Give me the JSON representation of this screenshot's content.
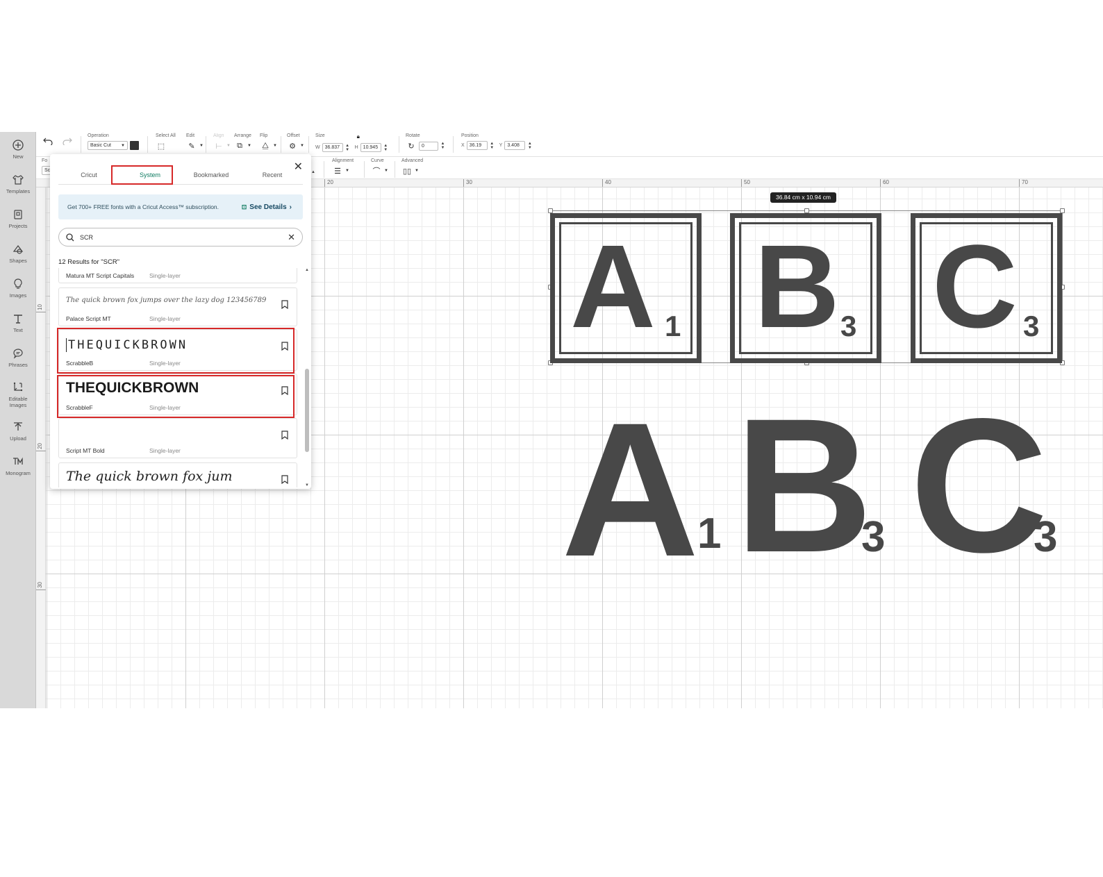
{
  "sidebar": {
    "items": [
      {
        "label": "New",
        "icon": "plus-circle-icon"
      },
      {
        "label": "Templates",
        "icon": "shirt-icon"
      },
      {
        "label": "Projects",
        "icon": "projects-icon"
      },
      {
        "label": "Shapes",
        "icon": "shapes-icon"
      },
      {
        "label": "Images",
        "icon": "lightbulb-icon"
      },
      {
        "label": "Text",
        "icon": "text-icon"
      },
      {
        "label": "Phrases",
        "icon": "speech-bubble-icon"
      },
      {
        "label": "Editable Images",
        "icon": "editable-images-icon"
      },
      {
        "label": "Upload",
        "icon": "upload-icon"
      },
      {
        "label": "Monogram",
        "icon": "monogram-icon"
      }
    ]
  },
  "toolbar": {
    "operation_label": "Operation",
    "operation_value": "Basic Cut",
    "select_all_label": "Select All",
    "edit_label": "Edit",
    "align_label": "Align",
    "arrange_label": "Arrange",
    "flip_label": "Flip",
    "offset_label": "Offset",
    "size_label": "Size",
    "w_label": "W",
    "w_value": "36.837",
    "h_label": "H",
    "h_value": "10.945",
    "rotate_label": "Rotate",
    "rotate_value": "0",
    "position_label": "Position",
    "x_label": "X",
    "x_value": "36.19",
    "y_label": "Y",
    "y_value": "3.408"
  },
  "toolbar2": {
    "font_label_partial": "Fo",
    "font_value_partial": "Sc",
    "alignment_label": "Alignment",
    "curve_label": "Curve",
    "advanced_label": "Advanced"
  },
  "rulers": {
    "top": [
      "20",
      "30",
      "40",
      "50",
      "60",
      "70"
    ],
    "left": [
      "10",
      "20",
      "30"
    ]
  },
  "font_panel": {
    "tabs": [
      "Cricut",
      "System",
      "Bookmarked",
      "Recent"
    ],
    "active_tab": "System",
    "banner_text": "Get 700+ FREE fonts with a Cricut Access™ subscription.",
    "banner_link": "See Details",
    "search_value": "SCR",
    "results_count": "12 Results for \"SCR\"",
    "fonts": [
      {
        "name": "Matura MT Script Capitals",
        "type": "Single-layer",
        "sample": ""
      },
      {
        "name": "Palace Script MT",
        "type": "Single-layer",
        "sample": "The quick brown fox jumps over the lazy dog 123456789"
      },
      {
        "name": "ScrabbleB",
        "type": "Single-layer",
        "sample": "THEQUICKBROWN"
      },
      {
        "name": "ScrabbleF",
        "type": "Single-layer",
        "sample": "THEQUICKBROWN"
      },
      {
        "name": "Script MT Bold",
        "type": "Single-layer",
        "sample": ""
      },
      {
        "name": "",
        "type": "",
        "sample": "The quick brown fox jum"
      }
    ]
  },
  "canvas": {
    "size_badge": "36.84  cm x 10.94  cm",
    "tiles": [
      {
        "letter": "A",
        "score": "1"
      },
      {
        "letter": "B",
        "score": "3"
      },
      {
        "letter": "C",
        "score": "3"
      }
    ],
    "large_letters": [
      {
        "letter": "A",
        "score": "1"
      },
      {
        "letter": "B",
        "score": "3"
      },
      {
        "letter": "C",
        "score": "3"
      }
    ]
  },
  "colors": {
    "accent": "#0d7a5f",
    "highlight": "#d62828",
    "glyph": "#484848",
    "banner_bg": "#e6f1f8"
  }
}
